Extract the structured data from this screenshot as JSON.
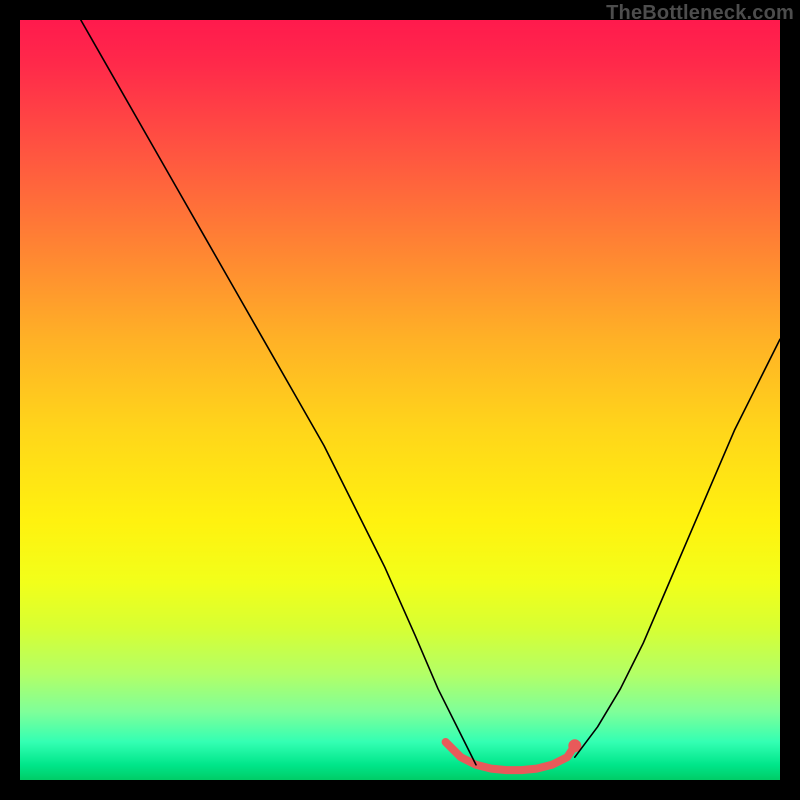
{
  "watermark": "TheBottleneck.com",
  "chart_data": {
    "type": "line",
    "title": "",
    "xlabel": "",
    "ylabel": "",
    "xlim": [
      0,
      100
    ],
    "ylim": [
      0,
      100
    ],
    "grid": false,
    "legend": false,
    "series": [
      {
        "name": "left-branch",
        "stroke": "#000000",
        "width": 1.6,
        "x": [
          8,
          12,
          16,
          20,
          24,
          28,
          32,
          36,
          40,
          44,
          48,
          52,
          55,
          58,
          60
        ],
        "y": [
          100,
          93,
          86,
          79,
          72,
          65,
          58,
          51,
          44,
          36,
          28,
          19,
          12,
          6,
          2
        ]
      },
      {
        "name": "right-branch",
        "stroke": "#000000",
        "width": 1.6,
        "x": [
          73,
          76,
          79,
          82,
          85,
          88,
          91,
          94,
          97,
          100
        ],
        "y": [
          3,
          7,
          12,
          18,
          25,
          32,
          39,
          46,
          52,
          58
        ]
      },
      {
        "name": "valley-highlight",
        "stroke": "#e85a5a",
        "width": 8,
        "x": [
          56,
          58,
          60,
          62,
          64,
          66,
          68,
          70,
          72,
          73
        ],
        "y": [
          5,
          3,
          2,
          1.5,
          1.3,
          1.3,
          1.5,
          2,
          3,
          4.5
        ]
      },
      {
        "name": "valley-dot",
        "stroke": "#e85a5a",
        "width": 9,
        "x": [
          73
        ],
        "y": [
          4.5
        ]
      }
    ],
    "background_gradient": {
      "top": "#ff1a4d",
      "mid": "#fff20f",
      "bottom": "#00cc66"
    }
  }
}
